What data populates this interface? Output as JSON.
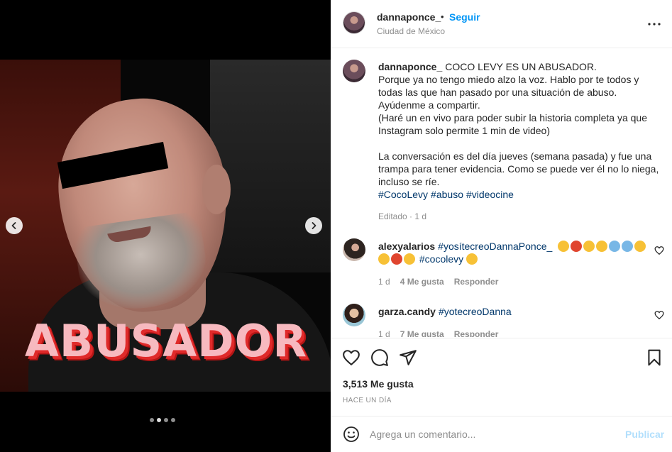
{
  "post": {
    "author": "dannaponce_",
    "separator": "•",
    "follow_label": "Seguir",
    "location": "Ciudad de México",
    "image_overlay_text": "ABUSADOR",
    "carousel": {
      "slides": 4,
      "active": 2
    },
    "icons": {
      "more": "more-options-icon",
      "prev": "chevron-left-icon",
      "next": "chevron-right-icon",
      "like": "heart-icon",
      "comment": "comment-icon",
      "share": "send-icon",
      "save": "bookmark-icon",
      "emoji": "smiley-icon"
    }
  },
  "caption": {
    "username": "dannaponce_",
    "lines": [
      "COCO LEVY ES UN ABUSADOR.",
      "Porque ya no tengo miedo alzo la voz. Hablo por te todos y todas las que han pasado por una situación de abuso.",
      "Ayúdenme a compartir.",
      "(Haré un en vivo para poder subir la historia completa ya que Instagram solo permite 1 min de video)",
      "La conversación es del día jueves (semana pasada) y fue una trampa para tener evidencia. Como se puede ver él no lo niega, incluso se ríe."
    ],
    "hashtags": [
      "#CocoLevy",
      "#abuso",
      "#videocine"
    ],
    "edited": "Editado · 1 d"
  },
  "comments": [
    {
      "username": "alexyalarios",
      "tags": [
        "#yosítecreoDannaPonce_"
      ],
      "tags_after": [
        "#cocolevy"
      ],
      "time": "1 d",
      "likes": "4 Me gusta",
      "reply": "Responder"
    },
    {
      "username": "garza.candy",
      "tags": [
        "#yotecreoDanna"
      ],
      "time": "1 d",
      "likes": "7 Me gusta",
      "reply": "Responder"
    }
  ],
  "footer": {
    "likes": "3,513 Me gusta",
    "timestamp": "HACE UN DÍA",
    "comment_placeholder": "Agrega un comentario...",
    "publish_label": "Publicar"
  },
  "colors": {
    "link_blue": "#0095f6",
    "hashtag": "#00376b",
    "muted": "#8e8e8e",
    "publish_disabled": "#b2dffc"
  }
}
